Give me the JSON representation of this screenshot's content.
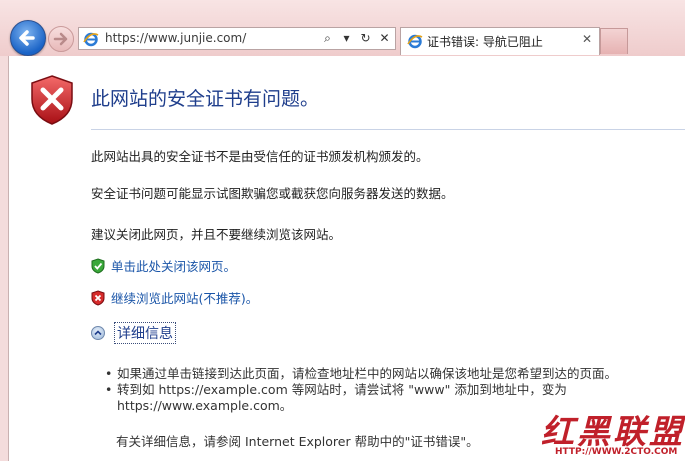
{
  "browser": {
    "address": "https://www.junjie.com/",
    "address_buttons": [
      "⌕",
      "▾",
      "↻",
      "✕"
    ],
    "tab": {
      "label": "证书错误: 导航已阻止",
      "close": "✕"
    }
  },
  "page": {
    "title": "此网站的安全证书有问题。",
    "paragraphs": [
      "此网站出具的安全证书不是由受信任的证书颁发机构颁发的。",
      "安全证书问题可能显示试图欺骗您或截获您向服务器发送的数据。",
      "建议关闭此网页，并且不要继续浏览该网站。"
    ],
    "close_link": "单击此处关闭该网页。",
    "continue_link": "继续浏览此网站(不推荐)。",
    "more_info": "详细信息",
    "bullets": [
      "如果通过单击链接到达此页面，请检查地址栏中的网站以确保该地址是您希望到达的页面。",
      "转到如 https://example.com 等网站时，请尝试将 \"www\" 添加到地址中，变为 https://www.example.com。"
    ],
    "footer": "有关详细信息，请参阅 Internet Explorer 帮助中的\"证书错误\"。"
  },
  "watermark": {
    "text": "红黑联盟",
    "url": "HTTP://WWW.2CTO.COM"
  }
}
